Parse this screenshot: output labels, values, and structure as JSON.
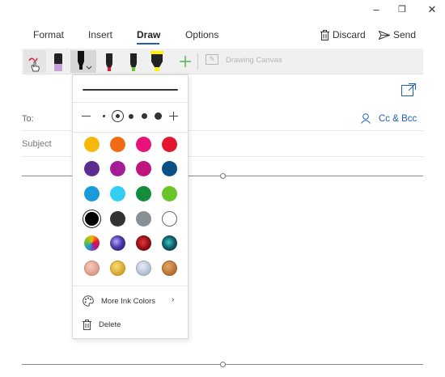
{
  "window_controls": {
    "minimize": "–",
    "restore": "❐",
    "close": "✕"
  },
  "tabs": [
    {
      "label": "Format"
    },
    {
      "label": "Insert"
    },
    {
      "label": "Draw",
      "active": true
    },
    {
      "label": "Options"
    }
  ],
  "actions": {
    "discard": "Discard",
    "send": "Send"
  },
  "toolbar": {
    "tools": [
      "touch-writing-icon",
      "pen-purple",
      "pen-black",
      "pen-red",
      "pen-green",
      "highlighter-yellow",
      "add-pen-icon"
    ],
    "drawing_canvas": "Drawing Canvas"
  },
  "mail": {
    "to_label": "To:",
    "cc_bcc": "Cc & Bcc",
    "subject_placeholder": "Subject"
  },
  "ink_flyout": {
    "thickness_levels": 5,
    "selected_thickness": 1,
    "colors": [
      [
        "#f6b80c",
        "#f26b14",
        "#e8137a",
        "#e3182e"
      ],
      [
        "#5c2d91",
        "#a51c97",
        "#c0157e",
        "#0b4f87"
      ],
      [
        "#1a9ad6",
        "#33cff3",
        "#138c3c",
        "#6ac52b"
      ],
      [
        "#000000",
        "#333333",
        "#8a8f94",
        "#ffffff"
      ],
      [
        "rainbow",
        "galaxy",
        "lava",
        "ocean"
      ],
      [
        "rose-gold",
        "gold",
        "silver",
        "bronze"
      ]
    ],
    "selected_color": "#000000",
    "more_colors": "More Ink Colors",
    "delete": "Delete"
  }
}
